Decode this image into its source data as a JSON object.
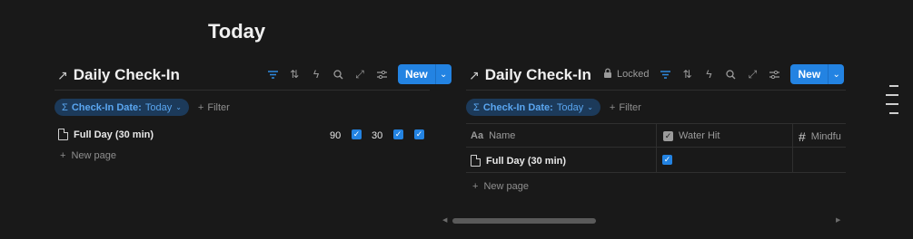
{
  "page": {
    "title": "Today"
  },
  "left_db": {
    "title": "Daily Check-In",
    "filter_chip": {
      "label": "Check-In Date:",
      "value": "Today"
    },
    "add_filter": "Filter",
    "new_label": "New",
    "row": {
      "title": "Full Day (30 min)",
      "value_1": "90",
      "value_2": "30"
    },
    "new_page": "New page"
  },
  "right_db": {
    "title": "Daily Check-In",
    "locked": "Locked",
    "filter_chip": {
      "label": "Check-In Date:",
      "value": "Today"
    },
    "add_filter": "Filter",
    "new_label": "New",
    "columns": {
      "name_icon": "Aa",
      "name": "Name",
      "water": "Water Hit",
      "mind_icon": "#",
      "mind": "Mindfu"
    },
    "row": {
      "title": "Full Day (30 min)"
    },
    "new_page": "New page"
  },
  "colors": {
    "accent": "#2383e2",
    "background": "#191919"
  }
}
